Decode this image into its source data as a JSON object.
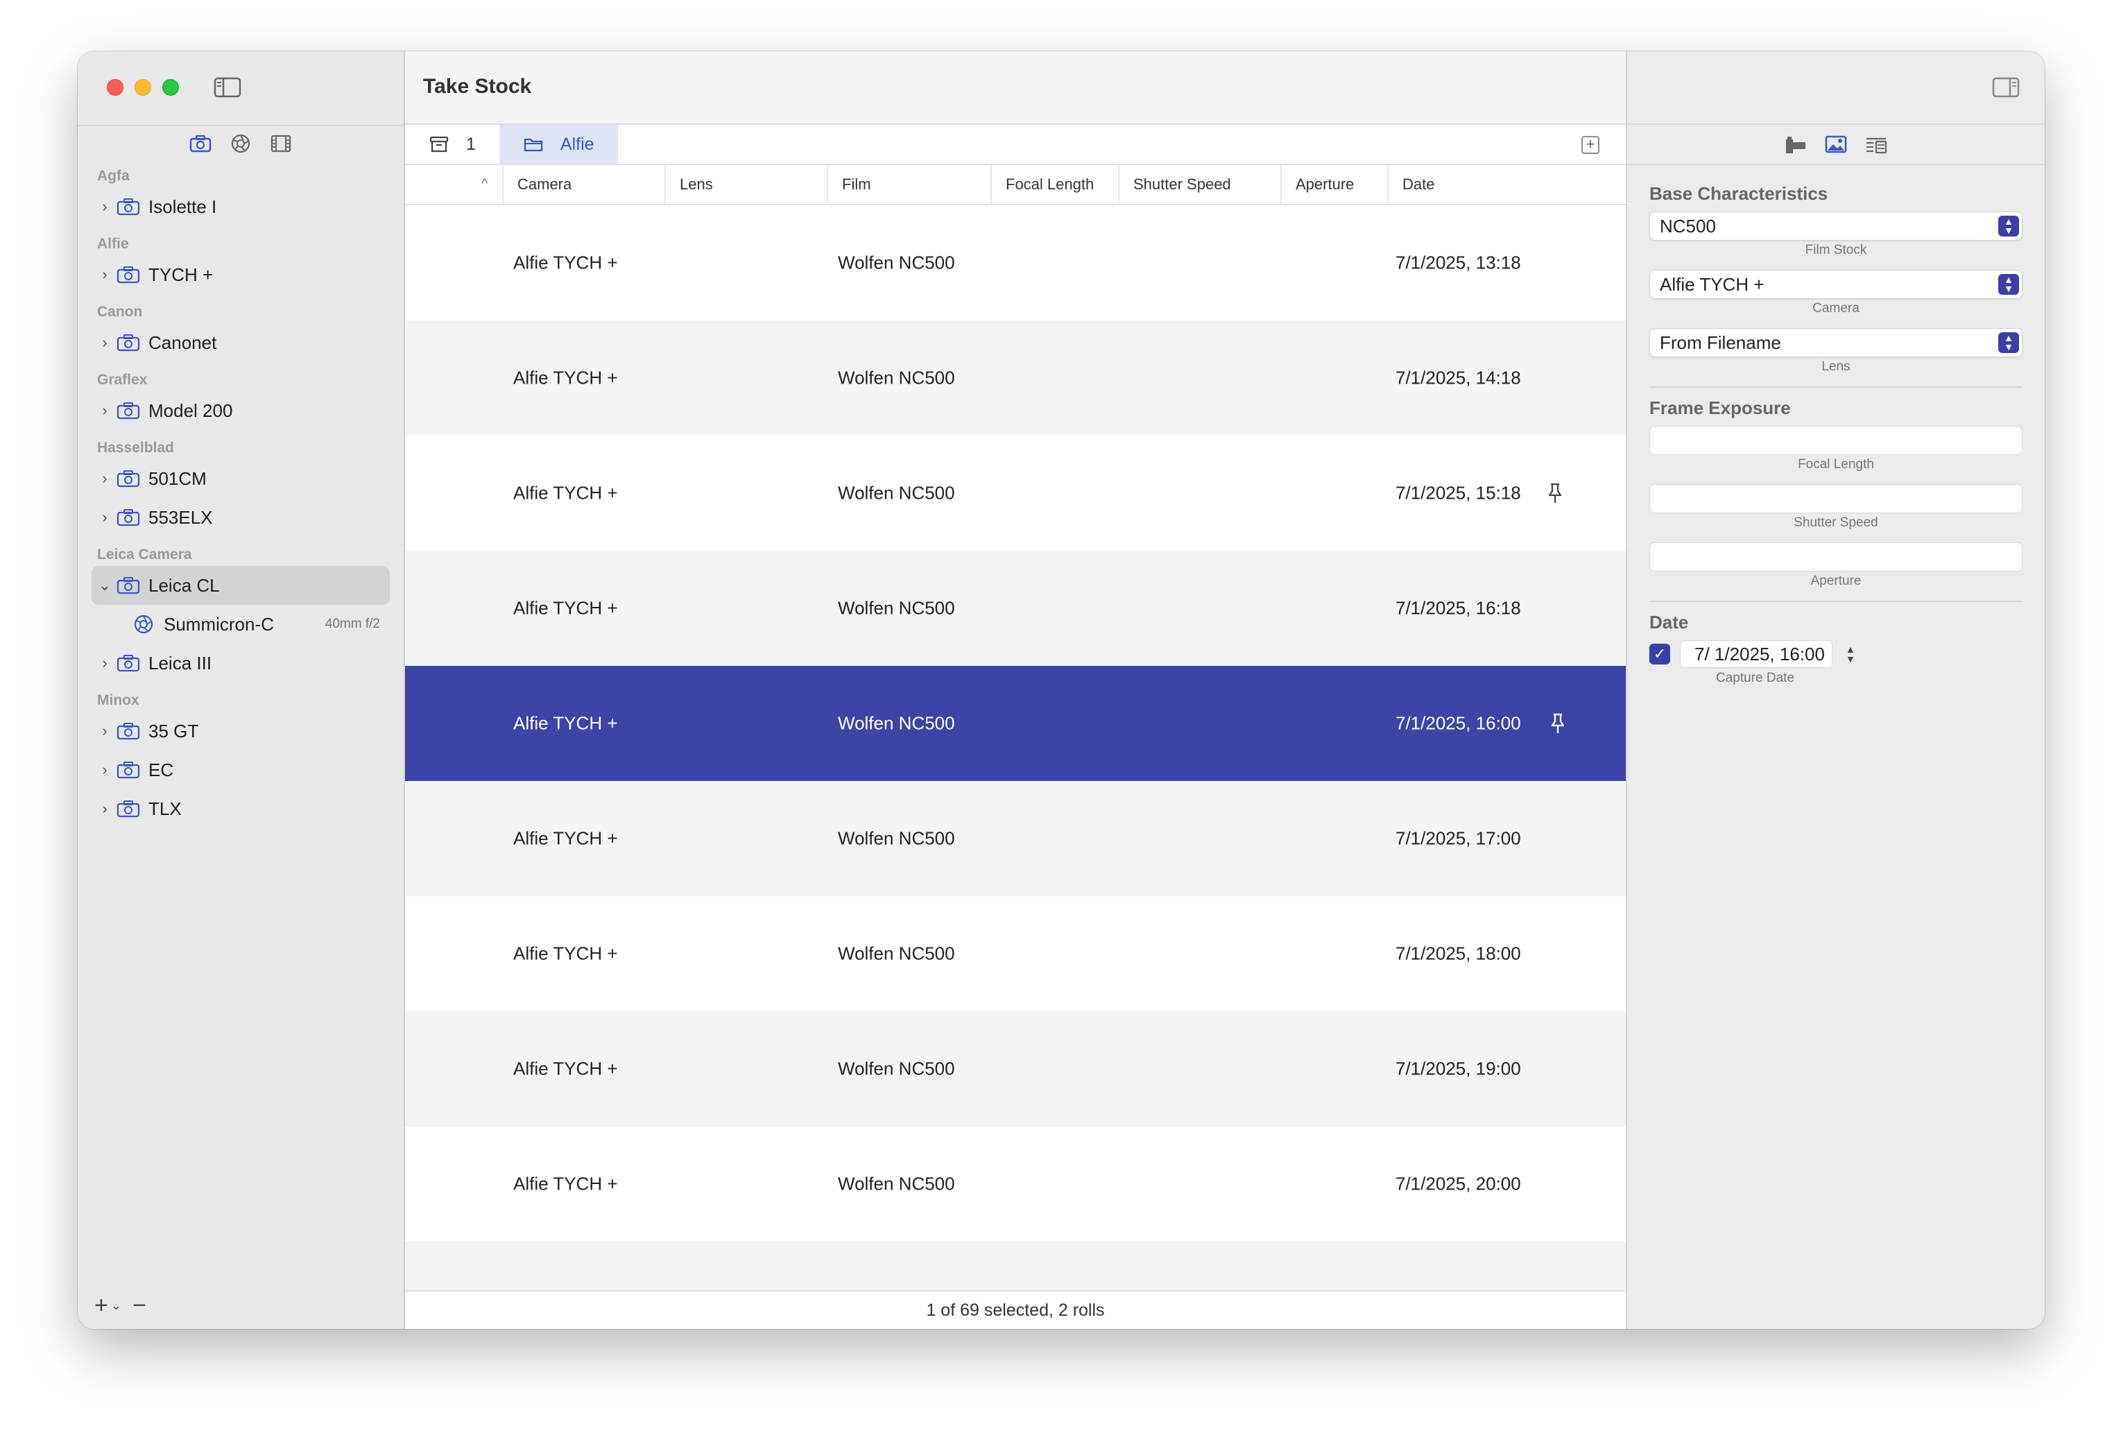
{
  "window": {
    "title": "Take Stock"
  },
  "sidebar": {
    "tab_icons": [
      "camera-icon",
      "aperture-icon",
      "film-icon"
    ],
    "groups": [
      {
        "brand": "Agfa",
        "items": [
          {
            "label": "Isolette I"
          }
        ]
      },
      {
        "brand": "Alfie",
        "items": [
          {
            "label": "TYCH +"
          }
        ]
      },
      {
        "brand": "Canon",
        "items": [
          {
            "label": "Canonet"
          }
        ]
      },
      {
        "brand": "Graflex",
        "items": [
          {
            "label": "Model 200"
          }
        ]
      },
      {
        "brand": "Hasselblad",
        "items": [
          {
            "label": "501CM"
          },
          {
            "label": "553ELX"
          }
        ]
      },
      {
        "brand": "Leica Camera",
        "items": [
          {
            "label": "Leica CL",
            "expanded": true,
            "selected": true
          },
          {
            "label": "Summicron-C",
            "meta": "40mm f/2",
            "child": true
          },
          {
            "label": "Leica III"
          }
        ]
      },
      {
        "brand": "Minox",
        "items": [
          {
            "label": "35 GT"
          },
          {
            "label": "EC"
          },
          {
            "label": "TLX"
          }
        ]
      }
    ],
    "bottom": {
      "add": "+",
      "add_menu": "⌄",
      "remove": "−"
    }
  },
  "main": {
    "tabs": [
      {
        "label": "1",
        "icon": "archive-icon"
      },
      {
        "label": "Alfie",
        "icon": "folder-icon",
        "active": true
      }
    ],
    "columns": [
      "Camera",
      "Lens",
      "Film",
      "Focal Length",
      "Shutter Speed",
      "Aperture",
      "Date"
    ],
    "sort_indicator": "^",
    "rows": [
      {
        "camera": "Alfie TYCH +",
        "lens": "",
        "film": "Wolfen NC500",
        "date": "7/1/2025, 13:18",
        "pinned": false,
        "selected": false
      },
      {
        "camera": "Alfie TYCH +",
        "lens": "",
        "film": "Wolfen NC500",
        "date": "7/1/2025, 14:18",
        "pinned": false,
        "selected": false
      },
      {
        "camera": "Alfie TYCH +",
        "lens": "",
        "film": "Wolfen NC500",
        "date": "7/1/2025, 15:18",
        "pinned": true,
        "selected": false
      },
      {
        "camera": "Alfie TYCH +",
        "lens": "",
        "film": "Wolfen NC500",
        "date": "7/1/2025, 16:18",
        "pinned": false,
        "selected": false
      },
      {
        "camera": "Alfie TYCH +",
        "lens": "",
        "film": "Wolfen NC500",
        "date": "7/1/2025, 16:00",
        "pinned": true,
        "selected": true
      },
      {
        "camera": "Alfie TYCH +",
        "lens": "",
        "film": "Wolfen NC500",
        "date": "7/1/2025, 17:00",
        "pinned": false,
        "selected": false
      },
      {
        "camera": "Alfie TYCH +",
        "lens": "",
        "film": "Wolfen NC500",
        "date": "7/1/2025, 18:00",
        "pinned": false,
        "selected": false
      },
      {
        "camera": "Alfie TYCH +",
        "lens": "",
        "film": "Wolfen NC500",
        "date": "7/1/2025, 19:00",
        "pinned": false,
        "selected": false
      },
      {
        "camera": "Alfie TYCH +",
        "lens": "",
        "film": "Wolfen NC500",
        "date": "7/1/2025, 20:00",
        "pinned": false,
        "selected": false
      }
    ],
    "status": "1 of 69 selected, 2 rolls"
  },
  "inspector": {
    "tab_icons": [
      "camera-icon",
      "photo-icon",
      "list-icon"
    ],
    "base_title": "Base Characteristics",
    "film_stock": {
      "value": "NC500",
      "caption": "Film Stock"
    },
    "camera": {
      "value": "Alfie TYCH +",
      "caption": "Camera"
    },
    "lens": {
      "value": "From Filename",
      "caption": "Lens"
    },
    "frame_title": "Frame Exposure",
    "focal_length": {
      "value": "",
      "caption": "Focal Length"
    },
    "shutter_speed": {
      "value": "",
      "caption": "Shutter Speed"
    },
    "aperture": {
      "value": "",
      "caption": "Aperture"
    },
    "date_title": "Date",
    "capture_date": {
      "checked": true,
      "value": "7/  1/2025, 16:00",
      "caption": "Capture Date"
    }
  },
  "colors": {
    "selection": "#3c44a8",
    "accent": "#3a3fa8",
    "tab_active_bg": "#dfe4f4",
    "close": "#fe5f57",
    "minimize": "#febc2e",
    "zoom": "#28c840"
  }
}
